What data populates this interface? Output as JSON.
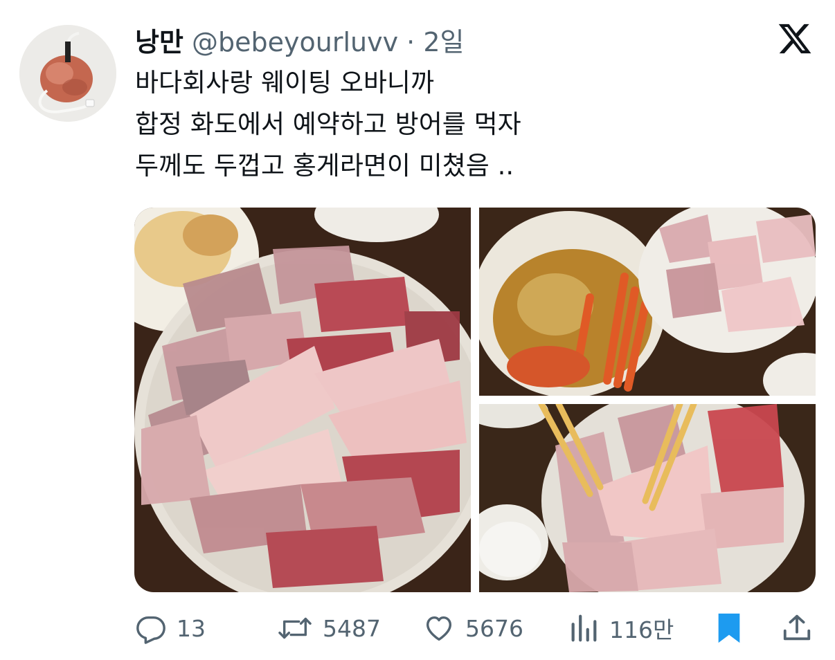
{
  "author": {
    "name": "낭만",
    "handle": "@bebeyourluvv",
    "separator": "·",
    "time": "2일"
  },
  "tweet": {
    "lines": [
      "바다회사랑 웨이팅 오바니까",
      "합정 화도에서 예약하고 방어를 먹자",
      "두께도 두껍고 홍게라면이 미쳤음 .."
    ]
  },
  "actions": {
    "replies": "13",
    "retweets": "5487",
    "likes": "5676",
    "views": "116만"
  },
  "icons": {
    "brand": "x-logo-icon",
    "reply": "reply-icon",
    "retweet": "retweet-icon",
    "like": "heart-icon",
    "views": "views-icon",
    "bookmark": "bookmark-icon",
    "share": "share-icon"
  },
  "colors": {
    "text": "#0f1419",
    "secondary": "#536471",
    "bookmark_active": "#1d9bf0"
  }
}
